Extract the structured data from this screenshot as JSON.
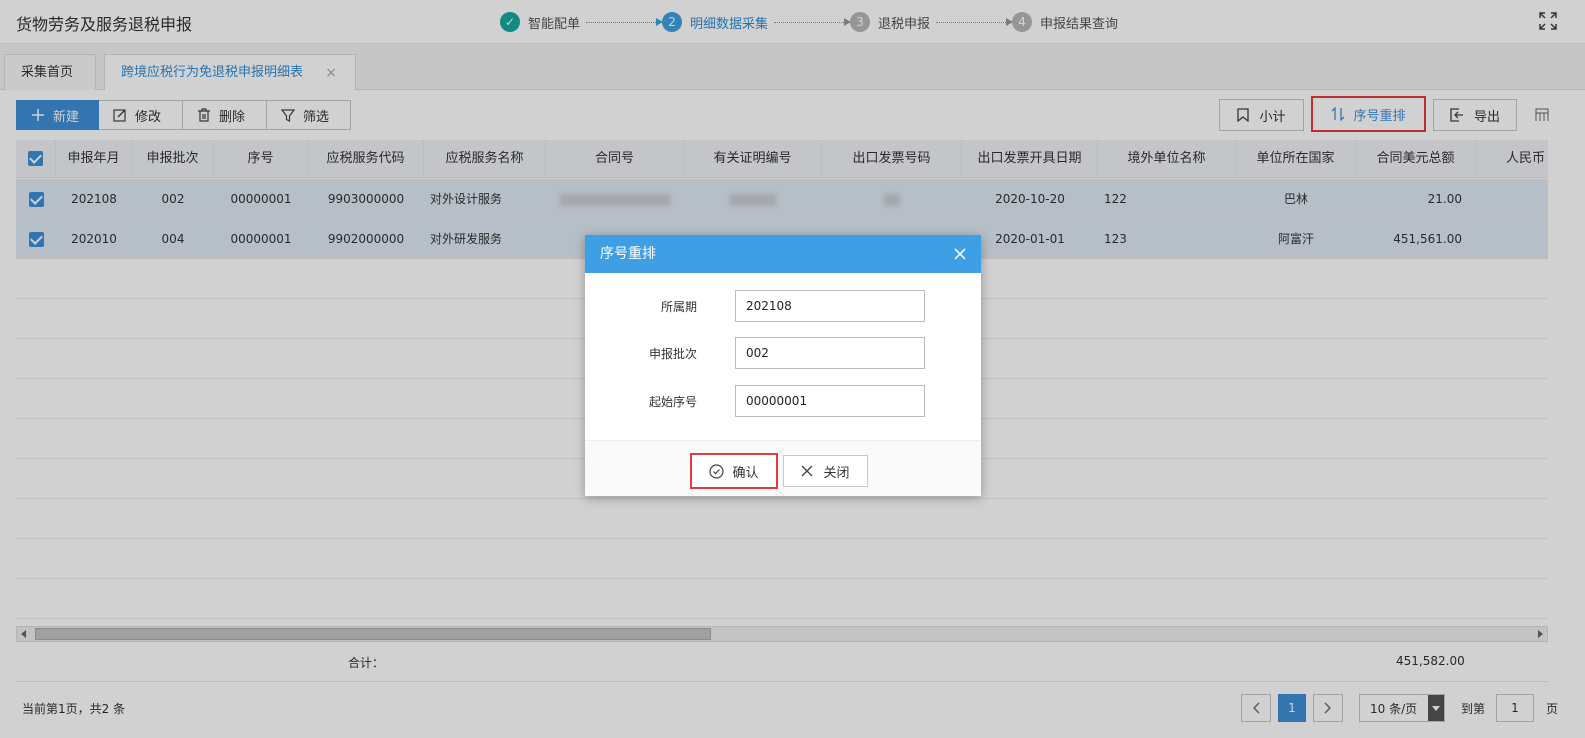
{
  "app": {
    "title": "货物劳务及服务退税申报"
  },
  "steps": [
    {
      "num": "✓",
      "label": "智能配单",
      "state": "done"
    },
    {
      "num": "2",
      "label": "明细数据采集",
      "state": "active"
    },
    {
      "num": "3",
      "label": "退税申报",
      "state": "todo"
    },
    {
      "num": "4",
      "label": "申报结果查询",
      "state": "todo"
    }
  ],
  "tabs": [
    {
      "label": "采集首页"
    },
    {
      "label": "跨境应税行为免退税申报明细表",
      "close": "×"
    }
  ],
  "toolbar": {
    "new_label": "新建",
    "edit_label": "修改",
    "delete_label": "删除",
    "filter_label": "筛选",
    "subtotal_label": "小计",
    "reorder_label": "序号重排",
    "export_label": "导出"
  },
  "table": {
    "columns": [
      "申报年月",
      "申报批次",
      "序号",
      "应税服务代码",
      "应税服务名称",
      "合同号",
      "有关证明编号",
      "出口发票号码",
      "出口发票开具日期",
      "境外单位名称",
      "单位所在国家",
      "合同美元总额",
      "人民币"
    ],
    "rows": [
      {
        "period": "202108",
        "batch": "002",
        "seq": "00000001",
        "code": "9903000000",
        "name": "对外设计服务",
        "date": "2020-10-20",
        "foreign_name": "122",
        "country": "巴林",
        "usd": "21.00"
      },
      {
        "period": "202010",
        "batch": "004",
        "seq": "00000001",
        "code": "9902000000",
        "name": "对外研发服务",
        "date": "2020-01-01",
        "foreign_name": "123",
        "country": "阿富汗",
        "usd": "451,561.00"
      }
    ],
    "sum_label": "合计：",
    "sum_value": "451,582.00"
  },
  "pager": {
    "info": "当前第1页，共2 条",
    "current": "1",
    "page_size": "10 条/页",
    "goto_label": "到第",
    "goto_value": "1",
    "page_unit": "页"
  },
  "dialog": {
    "title": "序号重排",
    "fields": [
      {
        "label": "所属期",
        "value": "202108"
      },
      {
        "label": "申报批次",
        "value": "002"
      },
      {
        "label": "起始序号",
        "value": "00000001"
      }
    ],
    "confirm_label": "确认",
    "close_label": "关闭"
  },
  "colors": {
    "accent": "#3f8fd8",
    "highlight": "#e23b3b",
    "dialog_header": "#3f9fe4",
    "step_done": "#17a8a0"
  }
}
